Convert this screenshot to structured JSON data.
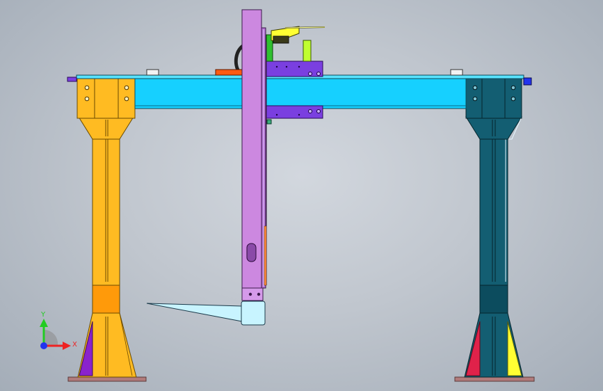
{
  "viewport": {
    "background_top": "#d2d7de",
    "background_bottom": "#a4adb8"
  },
  "model": {
    "parts": [
      {
        "name": "crossbeam",
        "color": "#16d0ff"
      },
      {
        "name": "left-column",
        "color": "#ffbb22"
      },
      {
        "name": "left-column-collar",
        "color": "#ff9a0a"
      },
      {
        "name": "right-column",
        "color": "#135e72"
      },
      {
        "name": "right-column-collar",
        "color": "#0c4c5e"
      },
      {
        "name": "vertical-mast",
        "color": "#cc88e0"
      },
      {
        "name": "carriage-plate",
        "color": "#7a3fe0"
      },
      {
        "name": "gripper-tip",
        "color": "#c8f4ff"
      },
      {
        "name": "yellow-bracket",
        "color": "#ffff33"
      },
      {
        "name": "green-block",
        "color": "#c0ff30"
      },
      {
        "name": "red-gusset",
        "color": "#e0224a"
      },
      {
        "name": "purple-gusset",
        "color": "#8a22cc"
      },
      {
        "name": "base-plate",
        "color": "#b07a7a"
      }
    ]
  },
  "triad": {
    "x_label": "X",
    "y_label": "Y",
    "x_color": "#ee2222",
    "y_color": "#22cc22",
    "z_color": "#2233ee"
  }
}
